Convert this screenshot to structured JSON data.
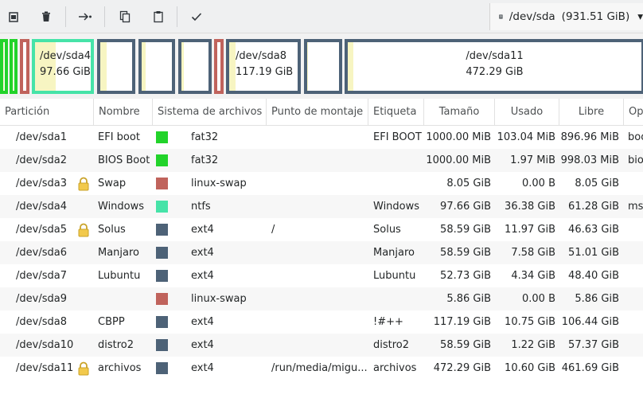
{
  "toolbar": {
    "buttons": [
      {
        "name": "new-partition-icon"
      },
      {
        "name": "delete-icon"
      },
      {
        "name": "resize-move-icon"
      },
      {
        "name": "copy-icon"
      },
      {
        "name": "paste-icon"
      },
      {
        "name": "apply-checkmark-icon"
      }
    ],
    "device": {
      "name": "/dev/sda",
      "size": "(931.51 GiB)",
      "icon": "disk-icon",
      "arrow": "▾"
    }
  },
  "map": {
    "segments": [
      {
        "name": "sda1",
        "label": "",
        "size": "",
        "border": "#22d32a",
        "used": 0.1,
        "text": false
      },
      {
        "name": "sda2",
        "label": "",
        "size": "",
        "border": "#22d32a",
        "used": 0.1,
        "text": false
      },
      {
        "name": "sda3",
        "label": "",
        "size": "",
        "border": "#c0635c",
        "used": 0.0,
        "text": false
      },
      {
        "name": "sda4",
        "label": "/dev/sda4",
        "size": "97.66 GiB",
        "border": "#46e3a8",
        "used": 0.37,
        "text": true
      },
      {
        "name": "sda5",
        "label": "",
        "size": "",
        "border": "#4d6277",
        "used": 0.2,
        "text": false
      },
      {
        "name": "sda6",
        "label": "",
        "size": "",
        "border": "#4d6277",
        "used": 0.13,
        "text": false
      },
      {
        "name": "sda7",
        "label": "",
        "size": "",
        "border": "#4d6277",
        "used": 0.08,
        "text": false
      },
      {
        "name": "sda9",
        "label": "",
        "size": "",
        "border": "#c0635c",
        "used": 0.0,
        "text": false
      },
      {
        "name": "sda8",
        "label": "/dev/sda8",
        "size": "117.19 GiB",
        "border": "#4d6277",
        "used": 0.09,
        "text": true
      },
      {
        "name": "sda10",
        "label": "",
        "size": "",
        "border": "#4d6277",
        "used": 0.02,
        "text": false
      },
      {
        "name": "sda11",
        "label": "/dev/sda11",
        "size": "472.29 GiB",
        "border": "#4d6277",
        "used": 0.02,
        "text": true
      }
    ]
  },
  "columns": [
    "Partición",
    "Nombre",
    "Sistema de archivos",
    "Punto de montaje",
    "Etiqueta",
    "Tamaño",
    "Usado",
    "Libre",
    "Op"
  ],
  "rows": [
    {
      "partition": "/dev/sda1",
      "name": "EFI boot",
      "locked": false,
      "fs": "fat32",
      "fs_color": "#22d32a",
      "mount": "",
      "label": "EFI BOOT",
      "size": "1000.00 MiB",
      "used": "103.04 MiB",
      "free": "896.96 MiB",
      "flags": "boot, esp"
    },
    {
      "partition": "/dev/sda2",
      "name": "BIOS Boot",
      "locked": false,
      "fs": "fat32",
      "fs_color": "#22d32a",
      "mount": "",
      "label": "",
      "size": "1000.00 MiB",
      "used": "1.97 MiB",
      "free": "998.03 MiB",
      "flags": "bios_grub"
    },
    {
      "partition": "/dev/sda3",
      "name": "Swap",
      "locked": true,
      "fs": "linux-swap",
      "fs_color": "#c0635c",
      "mount": "",
      "label": "",
      "size": "8.05 GiB",
      "used": "0.00 B",
      "free": "8.05 GiB",
      "flags": ""
    },
    {
      "partition": "/dev/sda4",
      "name": "Windows",
      "locked": false,
      "fs": "ntfs",
      "fs_color": "#46e3a8",
      "mount": "",
      "label": "Windows",
      "size": "97.66 GiB",
      "used": "36.38 GiB",
      "free": "61.28 GiB",
      "flags": "msftdata"
    },
    {
      "partition": "/dev/sda5",
      "name": "Solus",
      "locked": true,
      "fs": "ext4",
      "fs_color": "#4d6277",
      "mount": "/",
      "label": "Solus",
      "size": "58.59 GiB",
      "used": "11.97 GiB",
      "free": "46.63 GiB",
      "flags": ""
    },
    {
      "partition": "/dev/sda6",
      "name": "Manjaro",
      "locked": false,
      "fs": "ext4",
      "fs_color": "#4d6277",
      "mount": "",
      "label": "Manjaro",
      "size": "58.59 GiB",
      "used": "7.58 GiB",
      "free": "51.01 GiB",
      "flags": ""
    },
    {
      "partition": "/dev/sda7",
      "name": "Lubuntu",
      "locked": false,
      "fs": "ext4",
      "fs_color": "#4d6277",
      "mount": "",
      "label": "Lubuntu",
      "size": "52.73 GiB",
      "used": "4.34 GiB",
      "free": "48.40 GiB",
      "flags": ""
    },
    {
      "partition": "/dev/sda9",
      "name": "",
      "locked": false,
      "fs": "linux-swap",
      "fs_color": "#c0635c",
      "mount": "",
      "label": "",
      "size": "5.86 GiB",
      "used": "0.00 B",
      "free": "5.86 GiB",
      "flags": ""
    },
    {
      "partition": "/dev/sda8",
      "name": "CBPP",
      "locked": false,
      "fs": "ext4",
      "fs_color": "#4d6277",
      "mount": "",
      "label": "!#++",
      "size": "117.19 GiB",
      "used": "10.75 GiB",
      "free": "106.44 GiB",
      "flags": ""
    },
    {
      "partition": "/dev/sda10",
      "name": "distro2",
      "locked": false,
      "fs": "ext4",
      "fs_color": "#4d6277",
      "mount": "",
      "label": "distro2",
      "size": "58.59 GiB",
      "used": "1.22 GiB",
      "free": "57.37 GiB",
      "flags": ""
    },
    {
      "partition": "/dev/sda11",
      "name": "archivos",
      "locked": true,
      "fs": "ext4",
      "fs_color": "#4d6277",
      "mount": "/run/media/migu...",
      "label": "archivos",
      "size": "472.29 GiB",
      "used": "10.60 GiB",
      "free": "461.69 GiB",
      "flags": ""
    }
  ]
}
